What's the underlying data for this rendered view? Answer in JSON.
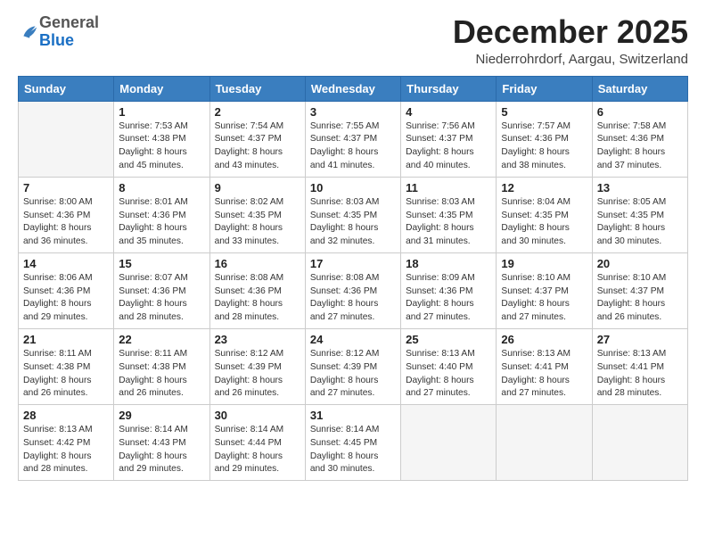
{
  "header": {
    "logo_general": "General",
    "logo_blue": "Blue",
    "month_title": "December 2025",
    "location": "Niederrohrdorf, Aargau, Switzerland"
  },
  "weekdays": [
    "Sunday",
    "Monday",
    "Tuesday",
    "Wednesday",
    "Thursday",
    "Friday",
    "Saturday"
  ],
  "weeks": [
    [
      {
        "day": "",
        "info": ""
      },
      {
        "day": "1",
        "info": "Sunrise: 7:53 AM\nSunset: 4:38 PM\nDaylight: 8 hours\nand 45 minutes."
      },
      {
        "day": "2",
        "info": "Sunrise: 7:54 AM\nSunset: 4:37 PM\nDaylight: 8 hours\nand 43 minutes."
      },
      {
        "day": "3",
        "info": "Sunrise: 7:55 AM\nSunset: 4:37 PM\nDaylight: 8 hours\nand 41 minutes."
      },
      {
        "day": "4",
        "info": "Sunrise: 7:56 AM\nSunset: 4:37 PM\nDaylight: 8 hours\nand 40 minutes."
      },
      {
        "day": "5",
        "info": "Sunrise: 7:57 AM\nSunset: 4:36 PM\nDaylight: 8 hours\nand 38 minutes."
      },
      {
        "day": "6",
        "info": "Sunrise: 7:58 AM\nSunset: 4:36 PM\nDaylight: 8 hours\nand 37 minutes."
      }
    ],
    [
      {
        "day": "7",
        "info": "Sunrise: 8:00 AM\nSunset: 4:36 PM\nDaylight: 8 hours\nand 36 minutes."
      },
      {
        "day": "8",
        "info": "Sunrise: 8:01 AM\nSunset: 4:36 PM\nDaylight: 8 hours\nand 35 minutes."
      },
      {
        "day": "9",
        "info": "Sunrise: 8:02 AM\nSunset: 4:35 PM\nDaylight: 8 hours\nand 33 minutes."
      },
      {
        "day": "10",
        "info": "Sunrise: 8:03 AM\nSunset: 4:35 PM\nDaylight: 8 hours\nand 32 minutes."
      },
      {
        "day": "11",
        "info": "Sunrise: 8:03 AM\nSunset: 4:35 PM\nDaylight: 8 hours\nand 31 minutes."
      },
      {
        "day": "12",
        "info": "Sunrise: 8:04 AM\nSunset: 4:35 PM\nDaylight: 8 hours\nand 30 minutes."
      },
      {
        "day": "13",
        "info": "Sunrise: 8:05 AM\nSunset: 4:35 PM\nDaylight: 8 hours\nand 30 minutes."
      }
    ],
    [
      {
        "day": "14",
        "info": "Sunrise: 8:06 AM\nSunset: 4:36 PM\nDaylight: 8 hours\nand 29 minutes."
      },
      {
        "day": "15",
        "info": "Sunrise: 8:07 AM\nSunset: 4:36 PM\nDaylight: 8 hours\nand 28 minutes."
      },
      {
        "day": "16",
        "info": "Sunrise: 8:08 AM\nSunset: 4:36 PM\nDaylight: 8 hours\nand 28 minutes."
      },
      {
        "day": "17",
        "info": "Sunrise: 8:08 AM\nSunset: 4:36 PM\nDaylight: 8 hours\nand 27 minutes."
      },
      {
        "day": "18",
        "info": "Sunrise: 8:09 AM\nSunset: 4:36 PM\nDaylight: 8 hours\nand 27 minutes."
      },
      {
        "day": "19",
        "info": "Sunrise: 8:10 AM\nSunset: 4:37 PM\nDaylight: 8 hours\nand 27 minutes."
      },
      {
        "day": "20",
        "info": "Sunrise: 8:10 AM\nSunset: 4:37 PM\nDaylight: 8 hours\nand 26 minutes."
      }
    ],
    [
      {
        "day": "21",
        "info": "Sunrise: 8:11 AM\nSunset: 4:38 PM\nDaylight: 8 hours\nand 26 minutes."
      },
      {
        "day": "22",
        "info": "Sunrise: 8:11 AM\nSunset: 4:38 PM\nDaylight: 8 hours\nand 26 minutes."
      },
      {
        "day": "23",
        "info": "Sunrise: 8:12 AM\nSunset: 4:39 PM\nDaylight: 8 hours\nand 26 minutes."
      },
      {
        "day": "24",
        "info": "Sunrise: 8:12 AM\nSunset: 4:39 PM\nDaylight: 8 hours\nand 27 minutes."
      },
      {
        "day": "25",
        "info": "Sunrise: 8:13 AM\nSunset: 4:40 PM\nDaylight: 8 hours\nand 27 minutes."
      },
      {
        "day": "26",
        "info": "Sunrise: 8:13 AM\nSunset: 4:41 PM\nDaylight: 8 hours\nand 27 minutes."
      },
      {
        "day": "27",
        "info": "Sunrise: 8:13 AM\nSunset: 4:41 PM\nDaylight: 8 hours\nand 28 minutes."
      }
    ],
    [
      {
        "day": "28",
        "info": "Sunrise: 8:13 AM\nSunset: 4:42 PM\nDaylight: 8 hours\nand 28 minutes."
      },
      {
        "day": "29",
        "info": "Sunrise: 8:14 AM\nSunset: 4:43 PM\nDaylight: 8 hours\nand 29 minutes."
      },
      {
        "day": "30",
        "info": "Sunrise: 8:14 AM\nSunset: 4:44 PM\nDaylight: 8 hours\nand 29 minutes."
      },
      {
        "day": "31",
        "info": "Sunrise: 8:14 AM\nSunset: 4:45 PM\nDaylight: 8 hours\nand 30 minutes."
      },
      {
        "day": "",
        "info": ""
      },
      {
        "day": "",
        "info": ""
      },
      {
        "day": "",
        "info": ""
      }
    ]
  ]
}
